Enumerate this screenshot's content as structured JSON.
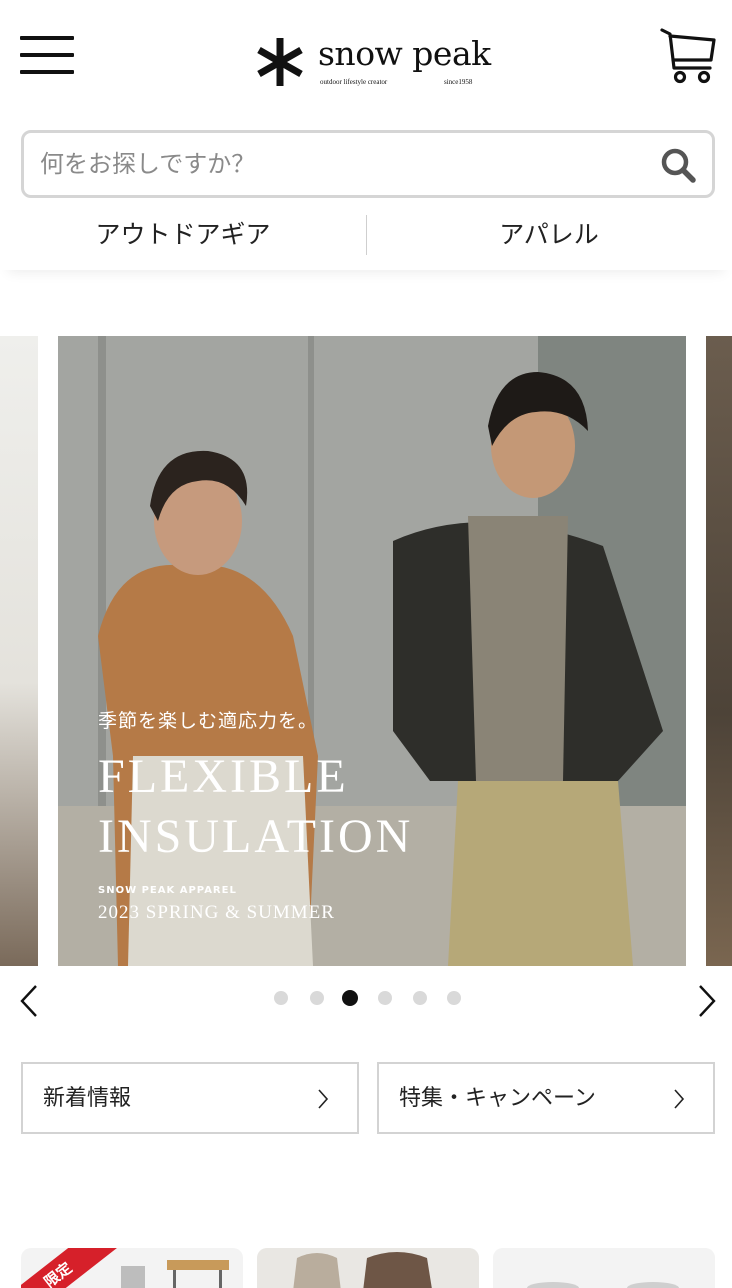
{
  "header": {
    "brand": "snow peak",
    "brand_tagline": "outdoor lifestyle creator",
    "brand_since": "since1958"
  },
  "search": {
    "placeholder": "何をお探しですか？"
  },
  "categories": [
    {
      "label": "アウトドアギア"
    },
    {
      "label": "アパレル"
    }
  ],
  "carousel": {
    "slide": {
      "subtitle": "季節を楽しむ適応力を。",
      "title_line1": "FLEXIBLE",
      "title_line2": "INSULATION",
      "brand": "SNOW PEAK APPAREL",
      "season": "2023 SPRING & SUMMER"
    },
    "dot_count": 6,
    "active_index": 2
  },
  "links": {
    "news": "新着情報",
    "feature": "特集・キャンペーン"
  },
  "cards": {
    "c1_ribbon": "限定"
  },
  "colors": {
    "accent_red": "#d6202a",
    "border": "#d3d3d3"
  }
}
